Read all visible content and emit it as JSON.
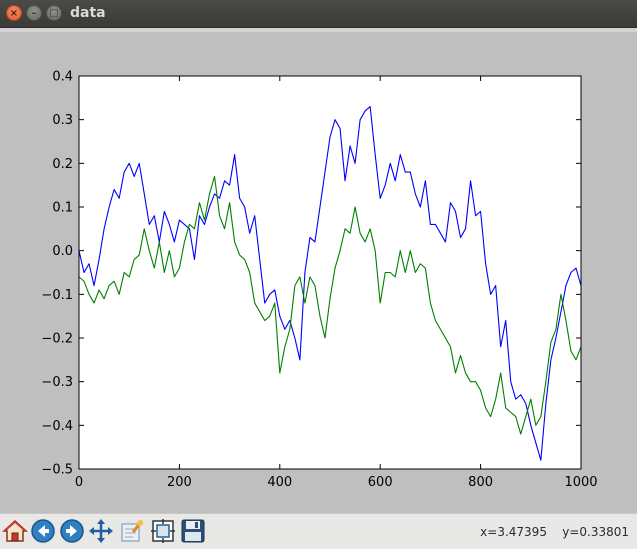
{
  "window": {
    "title": "data",
    "close_glyph": "×",
    "min_glyph": "–",
    "max_glyph": "□"
  },
  "toolbar": {
    "buttons": [
      {
        "name": "home-icon"
      },
      {
        "name": "back-icon"
      },
      {
        "name": "forward-icon"
      },
      {
        "name": "pan-icon"
      },
      {
        "name": "zoom-icon"
      },
      {
        "name": "configure-subplots-icon"
      },
      {
        "name": "save-icon"
      }
    ],
    "coords": "x=3.47395    y=0.33801"
  },
  "chart_data": {
    "type": "line",
    "xlim": [
      0,
      1000
    ],
    "ylim": [
      -0.5,
      0.4
    ],
    "x_ticks": [
      0,
      200,
      400,
      600,
      800,
      1000
    ],
    "x_tick_labels": [
      "0",
      "200",
      "400",
      "600",
      "800",
      "1000"
    ],
    "y_ticks": [
      0.4,
      0.3,
      0.2,
      0.1,
      0.0,
      -0.1,
      -0.2,
      -0.3,
      -0.4,
      -0.5
    ],
    "y_tick_labels": [
      "0.4",
      "0.3",
      "0.2",
      "0.1",
      "0.0",
      "−0.1",
      "−0.2",
      "−0.3",
      "−0.4",
      "−0.5"
    ],
    "grid": false,
    "series": [
      {
        "color": "#0000ff",
        "x": [
          0,
          10,
          20,
          30,
          40,
          50,
          60,
          70,
          80,
          90,
          100,
          110,
          120,
          130,
          140,
          150,
          160,
          170,
          180,
          190,
          200,
          210,
          220,
          230,
          240,
          250,
          260,
          270,
          280,
          290,
          300,
          310,
          320,
          330,
          340,
          350,
          360,
          370,
          380,
          390,
          400,
          410,
          420,
          430,
          440,
          450,
          460,
          470,
          480,
          490,
          500,
          510,
          520,
          530,
          540,
          550,
          560,
          570,
          580,
          590,
          600,
          610,
          620,
          630,
          640,
          650,
          660,
          670,
          680,
          690,
          700,
          710,
          720,
          730,
          740,
          750,
          760,
          770,
          780,
          790,
          800,
          810,
          820,
          830,
          840,
          850,
          860,
          870,
          880,
          890,
          900,
          910,
          920,
          930,
          940,
          950,
          960,
          970,
          980,
          990,
          1000
        ],
        "values": [
          0.0,
          -0.05,
          -0.03,
          -0.08,
          -0.02,
          0.05,
          0.1,
          0.14,
          0.12,
          0.18,
          0.2,
          0.17,
          0.2,
          0.13,
          0.06,
          0.08,
          0.02,
          0.09,
          0.06,
          0.02,
          0.07,
          0.06,
          0.05,
          -0.02,
          0.08,
          0.06,
          0.1,
          0.13,
          0.12,
          0.16,
          0.15,
          0.22,
          0.12,
          0.1,
          0.04,
          0.08,
          -0.02,
          -0.12,
          -0.1,
          -0.09,
          -0.15,
          -0.18,
          -0.16,
          -0.2,
          -0.25,
          -0.05,
          0.03,
          0.02,
          0.1,
          0.18,
          0.26,
          0.3,
          0.28,
          0.16,
          0.24,
          0.2,
          0.3,
          0.32,
          0.33,
          0.22,
          0.12,
          0.15,
          0.2,
          0.16,
          0.22,
          0.18,
          0.18,
          0.13,
          0.1,
          0.16,
          0.06,
          0.06,
          0.04,
          0.02,
          0.11,
          0.09,
          0.03,
          0.05,
          0.16,
          0.08,
          0.09,
          -0.03,
          -0.1,
          -0.08,
          -0.22,
          -0.16,
          -0.3,
          -0.34,
          -0.33,
          -0.35,
          -0.4,
          -0.44,
          -0.48,
          -0.35,
          -0.25,
          -0.2,
          -0.14,
          -0.08,
          -0.05,
          -0.04,
          -0.08
        ]
      },
      {
        "color": "#008000",
        "x": [
          0,
          10,
          20,
          30,
          40,
          50,
          60,
          70,
          80,
          90,
          100,
          110,
          120,
          130,
          140,
          150,
          160,
          170,
          180,
          190,
          200,
          210,
          220,
          230,
          240,
          250,
          260,
          270,
          280,
          290,
          300,
          310,
          320,
          330,
          340,
          350,
          360,
          370,
          380,
          390,
          400,
          410,
          420,
          430,
          440,
          450,
          460,
          470,
          480,
          490,
          500,
          510,
          520,
          530,
          540,
          550,
          560,
          570,
          580,
          590,
          600,
          610,
          620,
          630,
          640,
          650,
          660,
          670,
          680,
          690,
          700,
          710,
          720,
          730,
          740,
          750,
          760,
          770,
          780,
          790,
          800,
          810,
          820,
          830,
          840,
          850,
          860,
          870,
          880,
          890,
          900,
          910,
          920,
          930,
          940,
          950,
          960,
          970,
          980,
          990,
          1000
        ],
        "values": [
          -0.06,
          -0.07,
          -0.1,
          -0.12,
          -0.09,
          -0.11,
          -0.08,
          -0.07,
          -0.1,
          -0.05,
          -0.06,
          -0.02,
          -0.01,
          0.05,
          0.0,
          -0.04,
          0.02,
          -0.05,
          0.0,
          -0.06,
          -0.04,
          0.02,
          0.06,
          0.05,
          0.11,
          0.07,
          0.13,
          0.17,
          0.08,
          0.05,
          0.11,
          0.02,
          -0.01,
          -0.02,
          -0.05,
          -0.12,
          -0.14,
          -0.16,
          -0.15,
          -0.12,
          -0.28,
          -0.22,
          -0.18,
          -0.08,
          -0.06,
          -0.12,
          -0.06,
          -0.08,
          -0.15,
          -0.2,
          -0.11,
          -0.04,
          0.0,
          0.05,
          0.04,
          0.1,
          0.04,
          0.02,
          0.05,
          0.0,
          -0.12,
          -0.05,
          -0.05,
          -0.06,
          0.0,
          -0.05,
          0.0,
          -0.05,
          -0.03,
          -0.04,
          -0.12,
          -0.16,
          -0.18,
          -0.2,
          -0.22,
          -0.28,
          -0.24,
          -0.28,
          -0.3,
          -0.3,
          -0.32,
          -0.36,
          -0.38,
          -0.34,
          -0.28,
          -0.36,
          -0.37,
          -0.38,
          -0.42,
          -0.38,
          -0.34,
          -0.4,
          -0.38,
          -0.3,
          -0.21,
          -0.18,
          -0.1,
          -0.16,
          -0.23,
          -0.25,
          -0.22
        ]
      }
    ]
  }
}
